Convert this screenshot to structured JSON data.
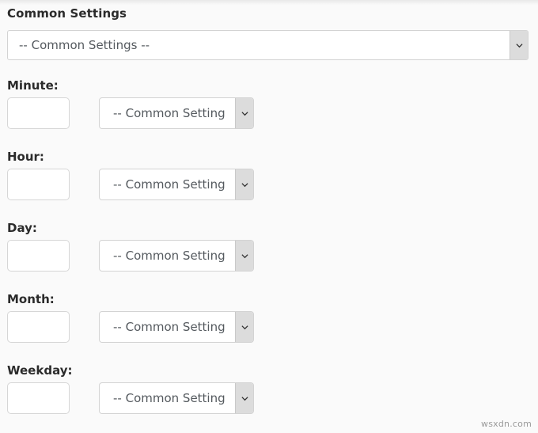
{
  "page": {
    "heading": "Common Settings",
    "background_color": "#fafafa",
    "watermark": "wsxdn.com"
  },
  "master_select": {
    "name": "common-settings",
    "selected": "-- Common Settings --",
    "options": [
      "-- Common Settings --"
    ]
  },
  "fields": [
    {
      "label": "Minute:",
      "input_value": "",
      "input_placeholder": "",
      "select_selected": "-- Common Setting",
      "select_options": [
        "-- Common Settings --"
      ]
    },
    {
      "label": "Hour:",
      "input_value": "",
      "input_placeholder": "",
      "select_selected": "-- Common Setting",
      "select_options": [
        "-- Common Settings --"
      ]
    },
    {
      "label": "Day:",
      "input_value": "",
      "input_placeholder": "",
      "select_selected": "-- Common Setting",
      "select_options": [
        "-- Common Settings --"
      ]
    },
    {
      "label": "Month:",
      "input_value": "",
      "input_placeholder": "",
      "select_selected": "-- Common Setting",
      "select_options": [
        "-- Common Settings --"
      ]
    },
    {
      "label": "Weekday:",
      "input_value": "",
      "input_placeholder": "",
      "select_selected": "-- Common Setting",
      "select_options": [
        "-- Common Settings --"
      ]
    }
  ],
  "icons": {
    "dropdown_arrow": "chevron-down-icon"
  }
}
